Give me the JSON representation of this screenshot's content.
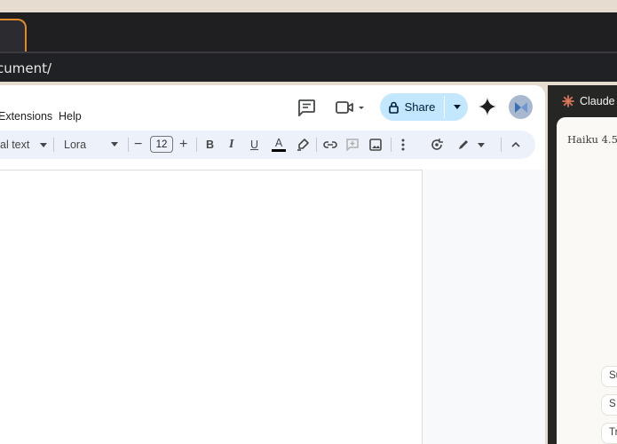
{
  "browser": {
    "tab_close": "×",
    "url": "cument/"
  },
  "docs": {
    "menu": [
      "Extensions",
      "Help"
    ],
    "share_label": "Share",
    "toolbar": {
      "style": "al text",
      "font": "Lora",
      "minus": "−",
      "font_size": "12",
      "plus": "+",
      "bold": "B",
      "italic": "I",
      "underline": "U",
      "text_color": "A"
    },
    "icons": [
      "comment-icon",
      "meet-icon",
      "lock-icon",
      "gemini-icon",
      "highlighter-icon",
      "link-icon",
      "add-comment-icon",
      "image-icon",
      "more-vert-icon",
      "spellcheck-icon",
      "edit-mode-icon",
      "collapse-icon"
    ]
  },
  "claude": {
    "title": "Claude",
    "model": "Haiku 4.5",
    "suggestions": [
      "Su",
      "S",
      "Tra"
    ]
  },
  "colors": {
    "accent_tab": "#e08b2c",
    "share_bg": "#c2e7ff",
    "toolbar_bg": "#edf2fa",
    "claude_logo": "#d97757"
  }
}
